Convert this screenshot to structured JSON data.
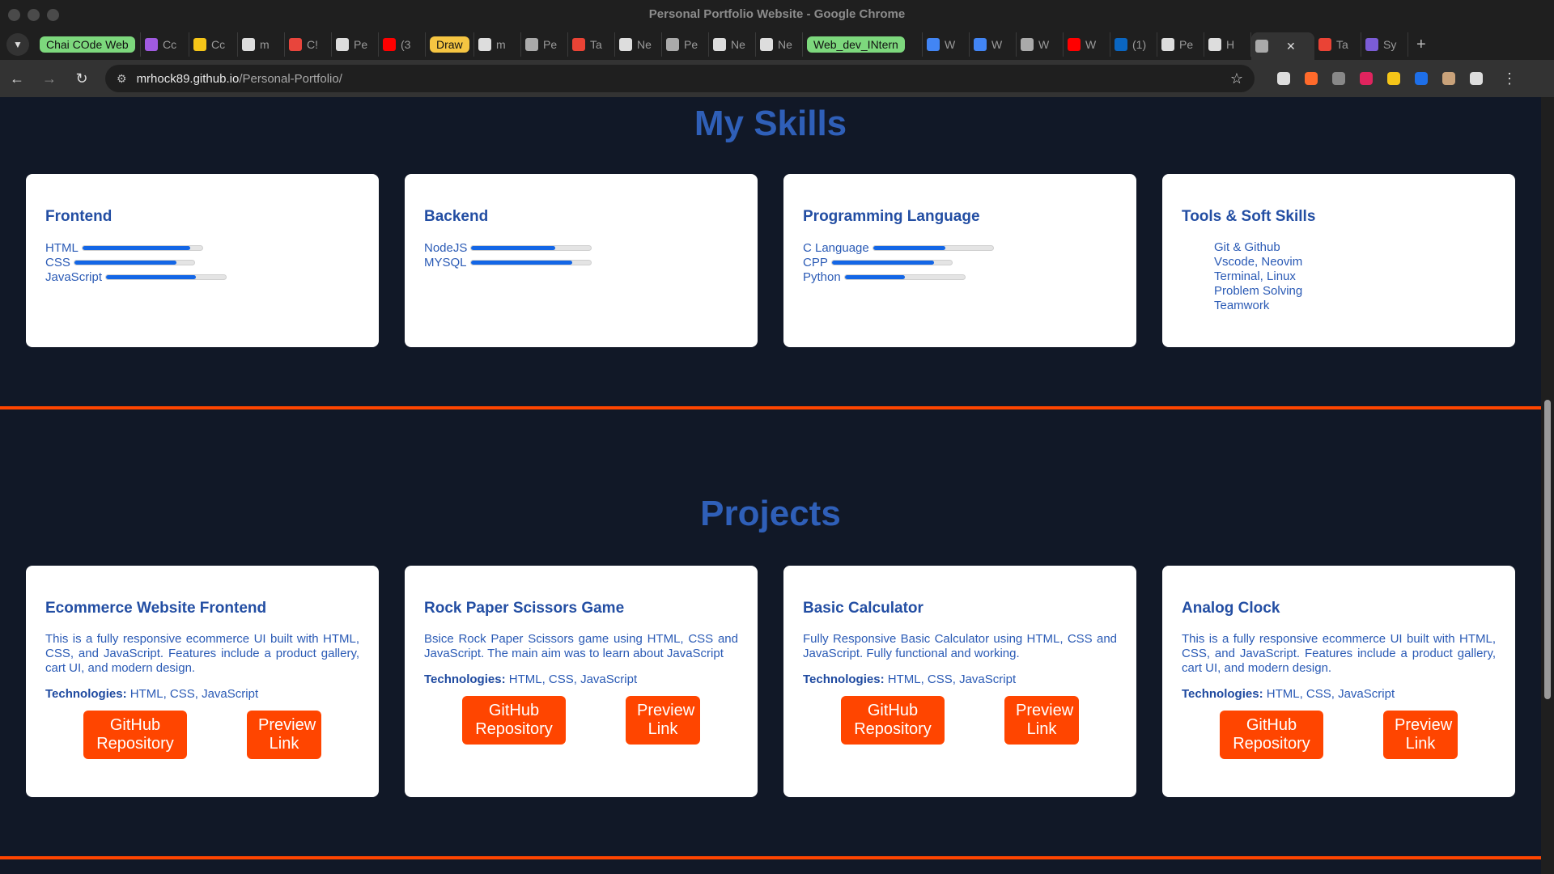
{
  "window": {
    "title": "Personal Portfolio Website - Google Chrome"
  },
  "tabs": [
    {
      "label": "Chai COde Web",
      "group": true,
      "group_color": "#7dd87d",
      "fav": "#7dd87d"
    },
    {
      "label": "Cc",
      "fav": "#a05ae0"
    },
    {
      "label": "Cc",
      "fav": "#f5c518"
    },
    {
      "label": "m",
      "fav": "#dddddd"
    },
    {
      "label": "C!",
      "fav": "#e8453c"
    },
    {
      "label": "Pe",
      "fav": "#dddddd"
    },
    {
      "label": "(3",
      "fav": "#ff0000"
    },
    {
      "label": "Draw",
      "group": true,
      "group_color": "#f5c542",
      "fav": "#f5c542"
    },
    {
      "label": "m",
      "fav": "#dddddd"
    },
    {
      "label": "Pe",
      "fav": "#aaaaaa"
    },
    {
      "label": "Ta",
      "fav": "#ea4335"
    },
    {
      "label": "Ne",
      "fav": "#dddddd"
    },
    {
      "label": "Pe",
      "fav": "#aaaaaa"
    },
    {
      "label": "Ne",
      "fav": "#dddddd"
    },
    {
      "label": "Ne",
      "fav": "#dddddd"
    },
    {
      "label": "Web_dev_INtern",
      "group": true,
      "group_color": "#7dd87d",
      "fav": "#7dd87d"
    },
    {
      "label": "W",
      "fav": "#4285f4"
    },
    {
      "label": "W",
      "fav": "#4285f4"
    },
    {
      "label": "W",
      "fav": "#aaaaaa"
    },
    {
      "label": "W",
      "fav": "#ff0000"
    },
    {
      "label": "(1)",
      "fav": "#0a66c2"
    },
    {
      "label": "Pe",
      "fav": "#dddddd"
    },
    {
      "label": "H",
      "fav": "#dddddd"
    },
    {
      "label": "",
      "active": true,
      "fav": "#aaaaaa"
    },
    {
      "label": "Ta",
      "fav": "#ea4335"
    },
    {
      "label": "Sy",
      "fav": "#7b5cd6"
    }
  ],
  "address_bar": {
    "host": "mrhock89.github.io",
    "path": "/Personal-Portfolio/"
  },
  "extensions": [
    "#dddddd",
    "#ff6a2b",
    "#888888",
    "#e0245e",
    "#f5c518",
    "#1e6fe8",
    "#c9a27a",
    "#dddddd"
  ],
  "skills": {
    "title": "My Skills",
    "cards": [
      {
        "title": "Frontend",
        "items": [
          {
            "name": "HTML",
            "level": 0.9
          },
          {
            "name": "CSS",
            "level": 0.85
          },
          {
            "name": "JavaScript",
            "level": 0.75
          }
        ]
      },
      {
        "title": "Backend",
        "items": [
          {
            "name": "NodeJS",
            "level": 0.7
          },
          {
            "name": "MYSQL",
            "level": 0.85
          }
        ]
      },
      {
        "title": "Programming Language",
        "items": [
          {
            "name": "C Language",
            "level": 0.6
          },
          {
            "name": "CPP",
            "level": 0.85
          },
          {
            "name": "Python",
            "level": 0.5
          }
        ]
      }
    ],
    "tools": {
      "title": "Tools & Soft Skills",
      "items": [
        "Git & Github",
        "Vscode, Neovim",
        "Terminal, Linux",
        "Problem Solving",
        "Teamwork"
      ]
    }
  },
  "projects": {
    "title": "Projects",
    "tech_label": "Technologies:",
    "cards": [
      {
        "title": "Ecommerce Website Frontend",
        "description": "This is a fully responsive ecommerce UI built with HTML, CSS, and JavaScript. Features include a product gallery, cart UI, and modern design.",
        "technologies": "HTML, CSS, JavaScript",
        "github_label": "GitHub Repository",
        "preview_label": "Preview Link"
      },
      {
        "title": "Rock Paper Scissors Game",
        "description": "Bsice Rock Paper Scissors game using HTML, CSS and JavaScript. The main aim was to learn about JavaScript",
        "technologies": "HTML, CSS, JavaScript",
        "github_label": "GitHub Repository",
        "preview_label": "Preview Link"
      },
      {
        "title": "Basic Calculator",
        "description": "Fully Responsive Basic Calculator using HTML, CSS and JavaScript. Fully functional and working.",
        "technologies": "HTML, CSS, JavaScript",
        "github_label": "GitHub Repository",
        "preview_label": "Preview Link"
      },
      {
        "title": "Analog Clock",
        "description": "This is a fully responsive ecommerce UI built with HTML, CSS, and JavaScript. Features include a product gallery, cart UI, and modern design.",
        "technologies": "HTML, CSS, JavaScript",
        "github_label": "GitHub Repository",
        "preview_label": "Preview Link"
      }
    ]
  }
}
